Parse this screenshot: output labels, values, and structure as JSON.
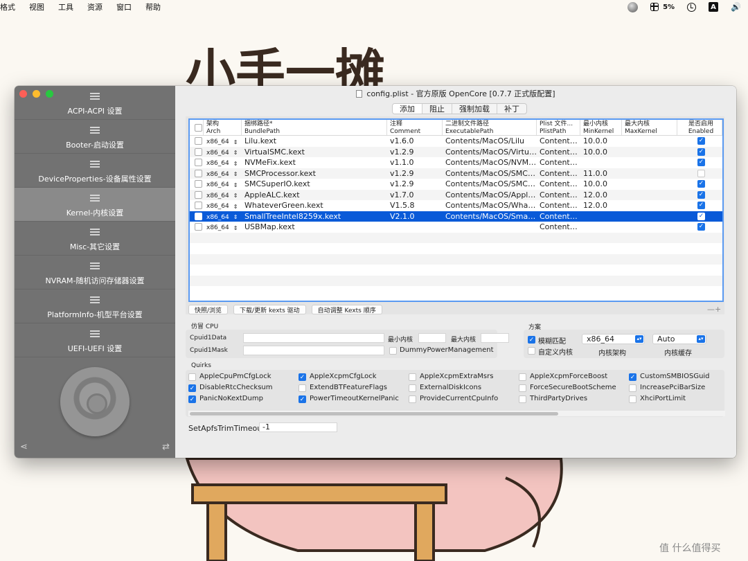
{
  "menubar": {
    "items": [
      "格式",
      "视图",
      "工具",
      "资源",
      "窗口",
      "帮助"
    ],
    "battery": "5%",
    "input_method": "A"
  },
  "background": {
    "title": "小手一摊"
  },
  "window": {
    "title": "config.plist - 官方原版 OpenCore [0.7.7 正式版配置]",
    "sidebar": [
      {
        "label": "ACPI-ACPI 设置"
      },
      {
        "label": "Booter-启动设置"
      },
      {
        "label": "DeviceProperties-设备属性设置"
      },
      {
        "label": "Kernel-内核设置"
      },
      {
        "label": "Misc-其它设置"
      },
      {
        "label": "NVRAM-随机访问存储器设置"
      },
      {
        "label": "PlatformInfo-机型平台设置"
      },
      {
        "label": "UEFI-UEFI 设置"
      }
    ],
    "active_sidebar": "Kernel-内核设置",
    "segments": [
      "添加",
      "阻止",
      "强制加载",
      "补丁"
    ],
    "active_segment": "添加"
  },
  "table": {
    "headers": [
      {
        "cn": "",
        "en": ""
      },
      {
        "cn": "架构",
        "en": "Arch"
      },
      {
        "cn": "捆绑路径*",
        "en": "BundlePath"
      },
      {
        "cn": "注释",
        "en": "Comment"
      },
      {
        "cn": "二进制文件路径",
        "en": "ExecutablePath"
      },
      {
        "cn": "Plist 文件...",
        "en": "PlistPath"
      },
      {
        "cn": "最小内核",
        "en": "MinKernel"
      },
      {
        "cn": "最大内核",
        "en": "MaxKernel"
      },
      {
        "cn": "是否启用",
        "en": "Enabled"
      }
    ],
    "rows": [
      {
        "arch": "x86_64",
        "bundle": "Lilu.kext",
        "comment": "v1.6.0",
        "exec": "Contents/MacOS/Lilu",
        "plist": "Contents...",
        "min": "10.0.0",
        "max": "",
        "enabled": true,
        "selected": false
      },
      {
        "arch": "x86_64",
        "bundle": "VirtualSMC.kext",
        "comment": "v1.2.9",
        "exec": "Contents/MacOS/Virtual...",
        "plist": "Contents...",
        "min": "10.0.0",
        "max": "",
        "enabled": true,
        "selected": false
      },
      {
        "arch": "x86_64",
        "bundle": "NVMeFix.kext",
        "comment": "v1.1.0",
        "exec": "Contents/MacOS/NVMeFix",
        "plist": "Contents...",
        "min": "",
        "max": "",
        "enabled": true,
        "selected": false
      },
      {
        "arch": "x86_64",
        "bundle": "SMCProcessor.kext",
        "comment": "v1.2.9",
        "exec": "Contents/MacOS/SMCPr...",
        "plist": "Contents...",
        "min": "11.0.0",
        "max": "",
        "enabled": false,
        "selected": false
      },
      {
        "arch": "x86_64",
        "bundle": "SMCSuperIO.kext",
        "comment": "v1.2.9",
        "exec": "Contents/MacOS/SMCS...",
        "plist": "Contents...",
        "min": "10.0.0",
        "max": "",
        "enabled": true,
        "selected": false
      },
      {
        "arch": "x86_64",
        "bundle": "AppleALC.kext",
        "comment": "v1.7.0",
        "exec": "Contents/MacOS/AppleA...",
        "plist": "Contents...",
        "min": "12.0.0",
        "max": "",
        "enabled": true,
        "selected": false
      },
      {
        "arch": "x86_64",
        "bundle": "WhateverGreen.kext",
        "comment": "V1.5.8",
        "exec": "Contents/MacOS/Whate...",
        "plist": "Contents...",
        "min": "12.0.0",
        "max": "",
        "enabled": true,
        "selected": false
      },
      {
        "arch": "x86_64",
        "bundle": "SmallTreeIntel8259x.kext",
        "comment": "V2.1.0",
        "exec": "Contents/MacOS/SmallT...",
        "plist": "Contents...",
        "min": "",
        "max": "",
        "enabled": true,
        "selected": true
      },
      {
        "arch": "x86_64",
        "bundle": "USBMap.kext",
        "comment": "",
        "exec": "",
        "plist": "Contents...",
        "min": "",
        "max": "",
        "enabled": true,
        "selected": false
      }
    ],
    "buttons": [
      "快照/浏览",
      "下载/更新 kexts 驱动",
      "自动调整 Kexts 顺序"
    ],
    "plus_minus": "—+"
  },
  "cpu": {
    "title": "仿冒 CPU",
    "cpuid1data_label": "Cpuid1Data",
    "cpuid1mask_label": "Cpuid1Mask",
    "min_kernel_label": "最小内核",
    "max_kernel_label": "最大内核",
    "dummy_label": "DummyPowerManagement",
    "dummy_checked": false
  },
  "scheme": {
    "title": "方案",
    "fuzzy_label": "模糊匹配",
    "fuzzy_checked": true,
    "custom_label": "自定义内核",
    "custom_checked": false,
    "arch_value": "x86_64",
    "arch_caption": "内核架构",
    "cache_value": "Auto",
    "cache_caption": "内核缓存"
  },
  "quirks": {
    "title": "Quirks",
    "items": [
      {
        "label": "AppleCpuPmCfgLock",
        "checked": false
      },
      {
        "label": "AppleXcpmCfgLock",
        "checked": true
      },
      {
        "label": "AppleXcpmExtraMsrs",
        "checked": false
      },
      {
        "label": "AppleXcpmForceBoost",
        "checked": false
      },
      {
        "label": "CustomSMBIOSGuid",
        "checked": true
      },
      {
        "label": "DisableRtcChecksum",
        "checked": true
      },
      {
        "label": "ExtendBTFeatureFlags",
        "checked": false
      },
      {
        "label": "ExternalDiskIcons",
        "checked": false
      },
      {
        "label": "ForceSecureBootScheme",
        "checked": false
      },
      {
        "label": "IncreasePciBarSize",
        "checked": false
      },
      {
        "label": "PanicNoKextDump",
        "checked": true
      },
      {
        "label": "PowerTimeoutKernelPanic",
        "checked": true
      },
      {
        "label": "ProvideCurrentCpuInfo",
        "checked": false
      },
      {
        "label": "ThirdPartyDrives",
        "checked": false
      },
      {
        "label": "XhciPortLimit",
        "checked": false
      }
    ],
    "apfs_label": "SetApfsTrimTimeout",
    "apfs_value": "-1"
  },
  "watermark": "值 什么值得买"
}
